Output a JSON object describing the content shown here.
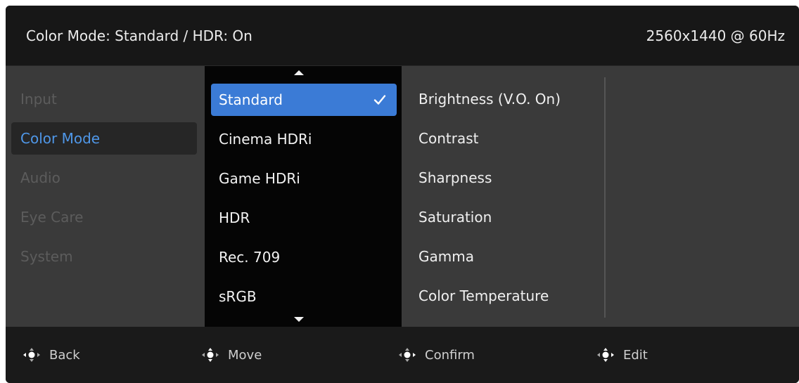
{
  "header": {
    "status": "Color Mode: Standard / HDR: On",
    "resolution": "2560x1440 @ 60Hz"
  },
  "categories": [
    {
      "label": "Input"
    },
    {
      "label": "Color Mode"
    },
    {
      "label": "Audio"
    },
    {
      "label": "Eye Care"
    },
    {
      "label": "System"
    }
  ],
  "active_category": "Color Mode",
  "options": [
    {
      "label": "Standard"
    },
    {
      "label": "Cinema HDRi"
    },
    {
      "label": "Game HDRi"
    },
    {
      "label": "HDR"
    },
    {
      "label": "Rec. 709"
    },
    {
      "label": "sRGB"
    }
  ],
  "selected_option": "Standard",
  "settings": [
    {
      "label": "Brightness (V.O. On)"
    },
    {
      "label": "Contrast"
    },
    {
      "label": "Sharpness"
    },
    {
      "label": "Saturation"
    },
    {
      "label": "Gamma"
    },
    {
      "label": "Color Temperature"
    }
  ],
  "footer": {
    "back": "Back",
    "move": "Move",
    "confirm": "Confirm",
    "edit": "Edit"
  },
  "colors": {
    "accent": "#3b7bd6",
    "active_text": "#4f97e8",
    "background": "#3a3a3a"
  }
}
